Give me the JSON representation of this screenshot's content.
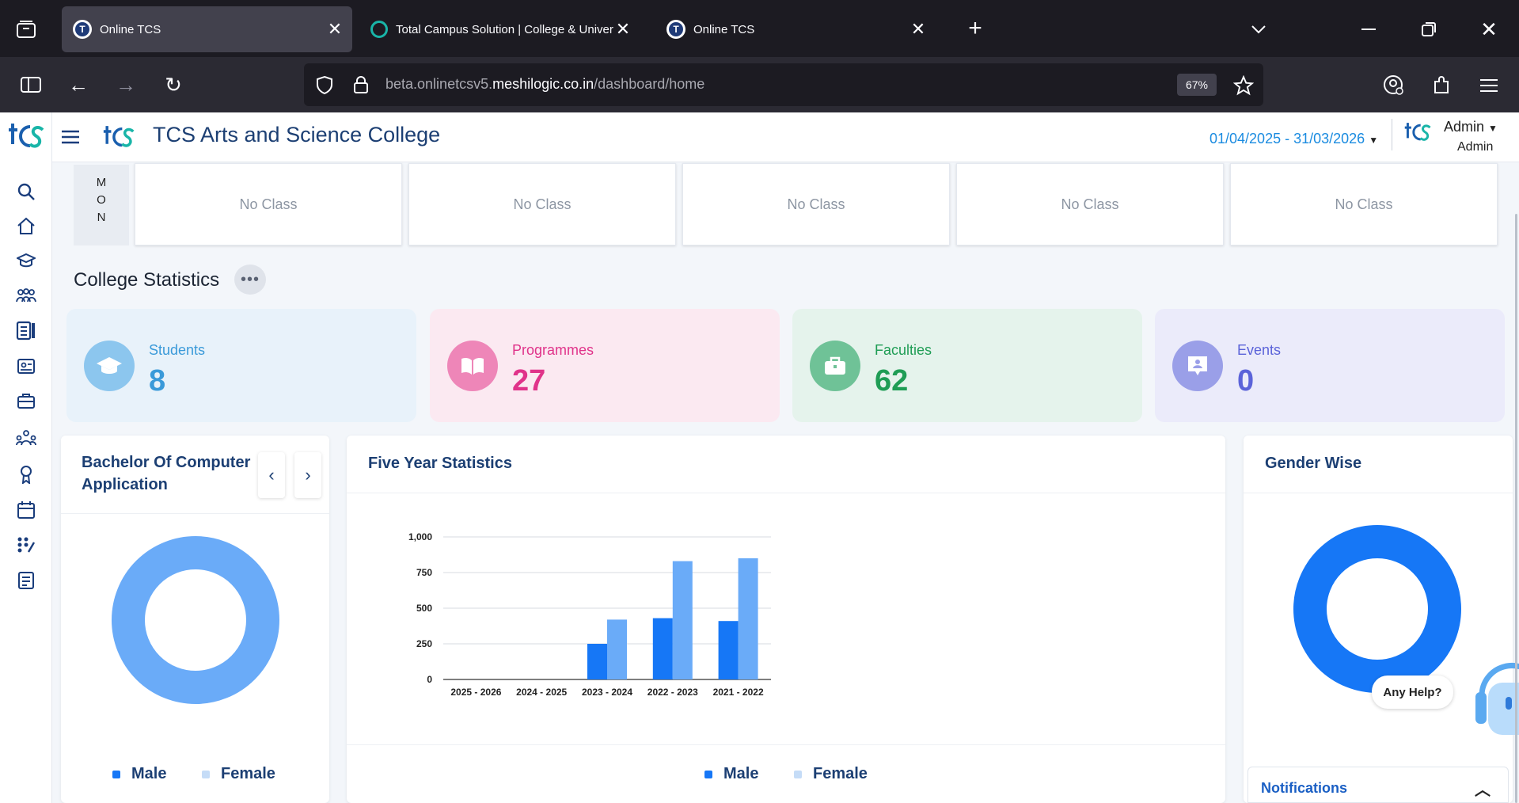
{
  "browser": {
    "tabs": [
      {
        "title": "Online TCS",
        "active": true
      },
      {
        "title": "Total Campus Solution | College & University",
        "active": false
      },
      {
        "title": "Online TCS",
        "active": false
      }
    ],
    "url_prefix": "beta.onlinetcsv5.",
    "url_domain": "meshilogic.co.in",
    "url_path": "/dashboard/home",
    "zoom": "67%"
  },
  "header": {
    "college_name": "TCS Arts and Science College",
    "date_range": "01/04/2025 - 31/03/2026",
    "user_name": "Admin",
    "user_role": "Admin"
  },
  "timetable": {
    "day": [
      "M",
      "O",
      "N"
    ],
    "slots": [
      "No Class",
      "No Class",
      "No Class",
      "No Class",
      "No Class"
    ]
  },
  "stats": {
    "title": "College Statistics",
    "items": [
      {
        "label": "Students",
        "value": "8",
        "color": "#3a9ad9",
        "bg": "#e8f2fa",
        "icon": "graduation-cap-icon"
      },
      {
        "label": "Programmes",
        "value": "27",
        "color": "#e0338a",
        "bg": "#fbe9f1",
        "icon": "book-icon"
      },
      {
        "label": "Faculties",
        "value": "62",
        "color": "#1f9d55",
        "bg": "#e5f3ec",
        "icon": "briefcase-icon"
      },
      {
        "label": "Events",
        "value": "0",
        "color": "#5b63d9",
        "bg": "#ebebfa",
        "icon": "event-icon"
      }
    ]
  },
  "programme_card": {
    "title": "Bachelor Of Computer Application",
    "legend": [
      "Male",
      "Female"
    ]
  },
  "five_year": {
    "title": "Five Year Statistics",
    "legend": [
      "Male",
      "Female"
    ]
  },
  "gender": {
    "title": "Gender Wise"
  },
  "help_label": "Any Help?",
  "notifications_label": "Notifications",
  "colors": {
    "male": "#1677f6",
    "female": "#6aabf8",
    "navy": "#1c3f73"
  },
  "chart_data": [
    {
      "type": "pie",
      "title": "Bachelor Of Computer Application",
      "categories": [
        "Male",
        "Female"
      ],
      "values": [
        0,
        100
      ],
      "style": "donut"
    },
    {
      "type": "bar",
      "title": "Five Year Statistics",
      "categories": [
        "2025 - 2026",
        "2024 - 2025",
        "2023 - 2024",
        "2022 - 2023",
        "2021 - 2022"
      ],
      "series": [
        {
          "name": "Male",
          "values": [
            0,
            0,
            250,
            430,
            410
          ]
        },
        {
          "name": "Female",
          "values": [
            0,
            0,
            420,
            830,
            850
          ]
        }
      ],
      "yticks": [
        "0",
        "250",
        "500",
        "750",
        "1,000"
      ],
      "ylim": [
        0,
        1000
      ]
    },
    {
      "type": "pie",
      "title": "Gender Wise",
      "categories": [
        "Male",
        "Female"
      ],
      "values": [
        100,
        0
      ],
      "style": "donut"
    }
  ]
}
